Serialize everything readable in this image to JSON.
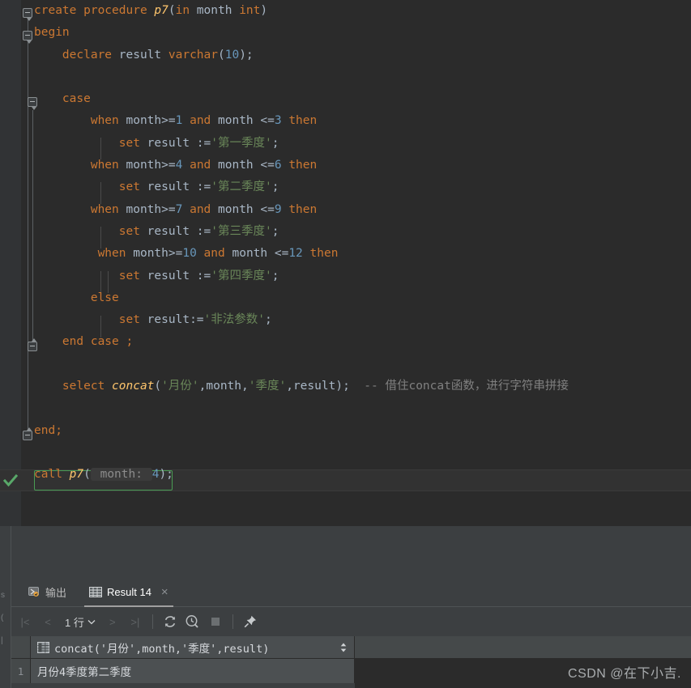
{
  "editor": {
    "language": "sql",
    "lines": [
      [
        {
          "t": "create procedure ",
          "c": "kw"
        },
        {
          "t": "p7",
          "c": "fn"
        },
        {
          "t": "(",
          "c": "pun"
        },
        {
          "t": "in",
          "c": "kw"
        },
        {
          "t": " month ",
          "c": "ident"
        },
        {
          "t": "int",
          "c": "kw"
        },
        {
          "t": ")",
          "c": "pun"
        }
      ],
      [
        {
          "t": "begin",
          "c": "kw"
        }
      ],
      [
        {
          "t": "    declare",
          "c": "kw"
        },
        {
          "t": " result ",
          "c": "ident"
        },
        {
          "t": "varchar",
          "c": "kw"
        },
        {
          "t": "(",
          "c": "pun"
        },
        {
          "t": "10",
          "c": "num"
        },
        {
          "t": ");",
          "c": "pun"
        }
      ],
      [],
      [
        {
          "t": "    case",
          "c": "kw"
        }
      ],
      [
        {
          "t": "        when",
          "c": "kw"
        },
        {
          "t": " month",
          "c": "ident"
        },
        {
          "t": ">=",
          "c": "pun"
        },
        {
          "t": "1",
          "c": "num"
        },
        {
          "t": " and",
          "c": "kw"
        },
        {
          "t": " month ",
          "c": "ident"
        },
        {
          "t": "<=",
          "c": "pun"
        },
        {
          "t": "3",
          "c": "num"
        },
        {
          "t": " then",
          "c": "kw"
        }
      ],
      [
        {
          "t": "            set",
          "c": "kw"
        },
        {
          "t": " result ",
          "c": "ident"
        },
        {
          "t": ":=",
          "c": "pun"
        },
        {
          "t": "'第一季度'",
          "c": "str"
        },
        {
          "t": ";",
          "c": "pun"
        }
      ],
      [
        {
          "t": "        when",
          "c": "kw"
        },
        {
          "t": " month",
          "c": "ident"
        },
        {
          "t": ">=",
          "c": "pun"
        },
        {
          "t": "4",
          "c": "num"
        },
        {
          "t": " and",
          "c": "kw"
        },
        {
          "t": " month ",
          "c": "ident"
        },
        {
          "t": "<=",
          "c": "pun"
        },
        {
          "t": "6",
          "c": "num"
        },
        {
          "t": " then",
          "c": "kw"
        }
      ],
      [
        {
          "t": "            set",
          "c": "kw"
        },
        {
          "t": " result ",
          "c": "ident"
        },
        {
          "t": ":=",
          "c": "pun"
        },
        {
          "t": "'第二季度'",
          "c": "str"
        },
        {
          "t": ";",
          "c": "pun"
        }
      ],
      [
        {
          "t": "        when",
          "c": "kw"
        },
        {
          "t": " month",
          "c": "ident"
        },
        {
          "t": ">=",
          "c": "pun"
        },
        {
          "t": "7",
          "c": "num"
        },
        {
          "t": " and",
          "c": "kw"
        },
        {
          "t": " month ",
          "c": "ident"
        },
        {
          "t": "<=",
          "c": "pun"
        },
        {
          "t": "9",
          "c": "num"
        },
        {
          "t": " then",
          "c": "kw"
        }
      ],
      [
        {
          "t": "            set",
          "c": "kw"
        },
        {
          "t": " result ",
          "c": "ident"
        },
        {
          "t": ":=",
          "c": "pun"
        },
        {
          "t": "'第三季度'",
          "c": "str"
        },
        {
          "t": ";",
          "c": "pun"
        }
      ],
      [
        {
          "t": "         when",
          "c": "kw"
        },
        {
          "t": " month",
          "c": "ident"
        },
        {
          "t": ">=",
          "c": "pun"
        },
        {
          "t": "10",
          "c": "num"
        },
        {
          "t": " and",
          "c": "kw"
        },
        {
          "t": " month ",
          "c": "ident"
        },
        {
          "t": "<=",
          "c": "pun"
        },
        {
          "t": "12",
          "c": "num"
        },
        {
          "t": " then",
          "c": "kw"
        }
      ],
      [
        {
          "t": "            set",
          "c": "kw"
        },
        {
          "t": " result ",
          "c": "ident"
        },
        {
          "t": ":=",
          "c": "pun"
        },
        {
          "t": "'第四季度'",
          "c": "str"
        },
        {
          "t": ";",
          "c": "pun"
        }
      ],
      [
        {
          "t": "        else",
          "c": "kw"
        }
      ],
      [
        {
          "t": "            set",
          "c": "kw"
        },
        {
          "t": " result",
          "c": "ident"
        },
        {
          "t": ":=",
          "c": "pun"
        },
        {
          "t": "'非法参数'",
          "c": "str"
        },
        {
          "t": ";",
          "c": "pun"
        }
      ],
      [
        {
          "t": "    end case ;",
          "c": "kw"
        }
      ],
      [],
      [
        {
          "t": "    select ",
          "c": "kw"
        },
        {
          "t": "concat",
          "c": "fn"
        },
        {
          "t": "(",
          "c": "pun"
        },
        {
          "t": "'月份'",
          "c": "str"
        },
        {
          "t": ",",
          "c": "pun"
        },
        {
          "t": "month",
          "c": "ident"
        },
        {
          "t": ",",
          "c": "pun"
        },
        {
          "t": "'季度'",
          "c": "str"
        },
        {
          "t": ",",
          "c": "pun"
        },
        {
          "t": "result",
          "c": "ident"
        },
        {
          "t": ");",
          "c": "pun"
        },
        {
          "t": "  -- 借住concat函数，进行字符串拼接",
          "c": "cmt"
        }
      ],
      [],
      [
        {
          "t": "end;",
          "c": "kw"
        }
      ],
      [],
      [
        {
          "t": "call ",
          "c": "kw"
        },
        {
          "t": "p7",
          "c": "fn"
        },
        {
          "t": "(",
          "c": "pun"
        },
        {
          "t": " month: ",
          "c": "hint"
        },
        {
          "t": "4",
          "c": "num"
        },
        {
          "t": ");",
          "c": "pun"
        }
      ]
    ],
    "run_line_index": 21,
    "run_status_icon": "check-icon",
    "colors": {
      "background": "#2b2b2b",
      "keyword": "#cc7832",
      "function": "#ffc66d",
      "number": "#6897bb",
      "string": "#6a8759",
      "comment": "#808080",
      "identifier": "#a9b7c6",
      "run_box_border": "#499c54",
      "caret_line": "#323232"
    }
  },
  "panel": {
    "tabs": [
      {
        "label": "输出",
        "icon": "output-icon",
        "active": false,
        "closable": false
      },
      {
        "label": "Result 14",
        "icon": "table-grid-icon",
        "active": true,
        "closable": true
      }
    ],
    "close_label": "×",
    "toolbar": {
      "first_page": "|<",
      "prev_page": "<",
      "rows_label": "1 行",
      "rows_chevron": "chevron-down-icon",
      "next_page": ">",
      "last_page": ">|",
      "refresh": "refresh-icon",
      "history": "history-clock-icon",
      "stop": "stop-icon",
      "pin": "pin-icon"
    },
    "grid": {
      "row_number_header": "",
      "columns": [
        {
          "name": "concat('月份',month,'季度',result)",
          "icon": "column-type-icon",
          "sort": "sort-arrows-icon"
        }
      ],
      "rows": [
        {
          "num": "1",
          "cells": [
            "月份4季度第二季度"
          ]
        }
      ]
    },
    "colors": {
      "panel_background": "#3c3f41",
      "header_background": "#4a4e50",
      "cell_selected": "#4c5052"
    }
  },
  "watermark": {
    "text": "CSDN @在下小吉."
  },
  "left_rail": {
    "glyphs": [
      "s",
      "(",
      "|",
      "|"
    ]
  }
}
